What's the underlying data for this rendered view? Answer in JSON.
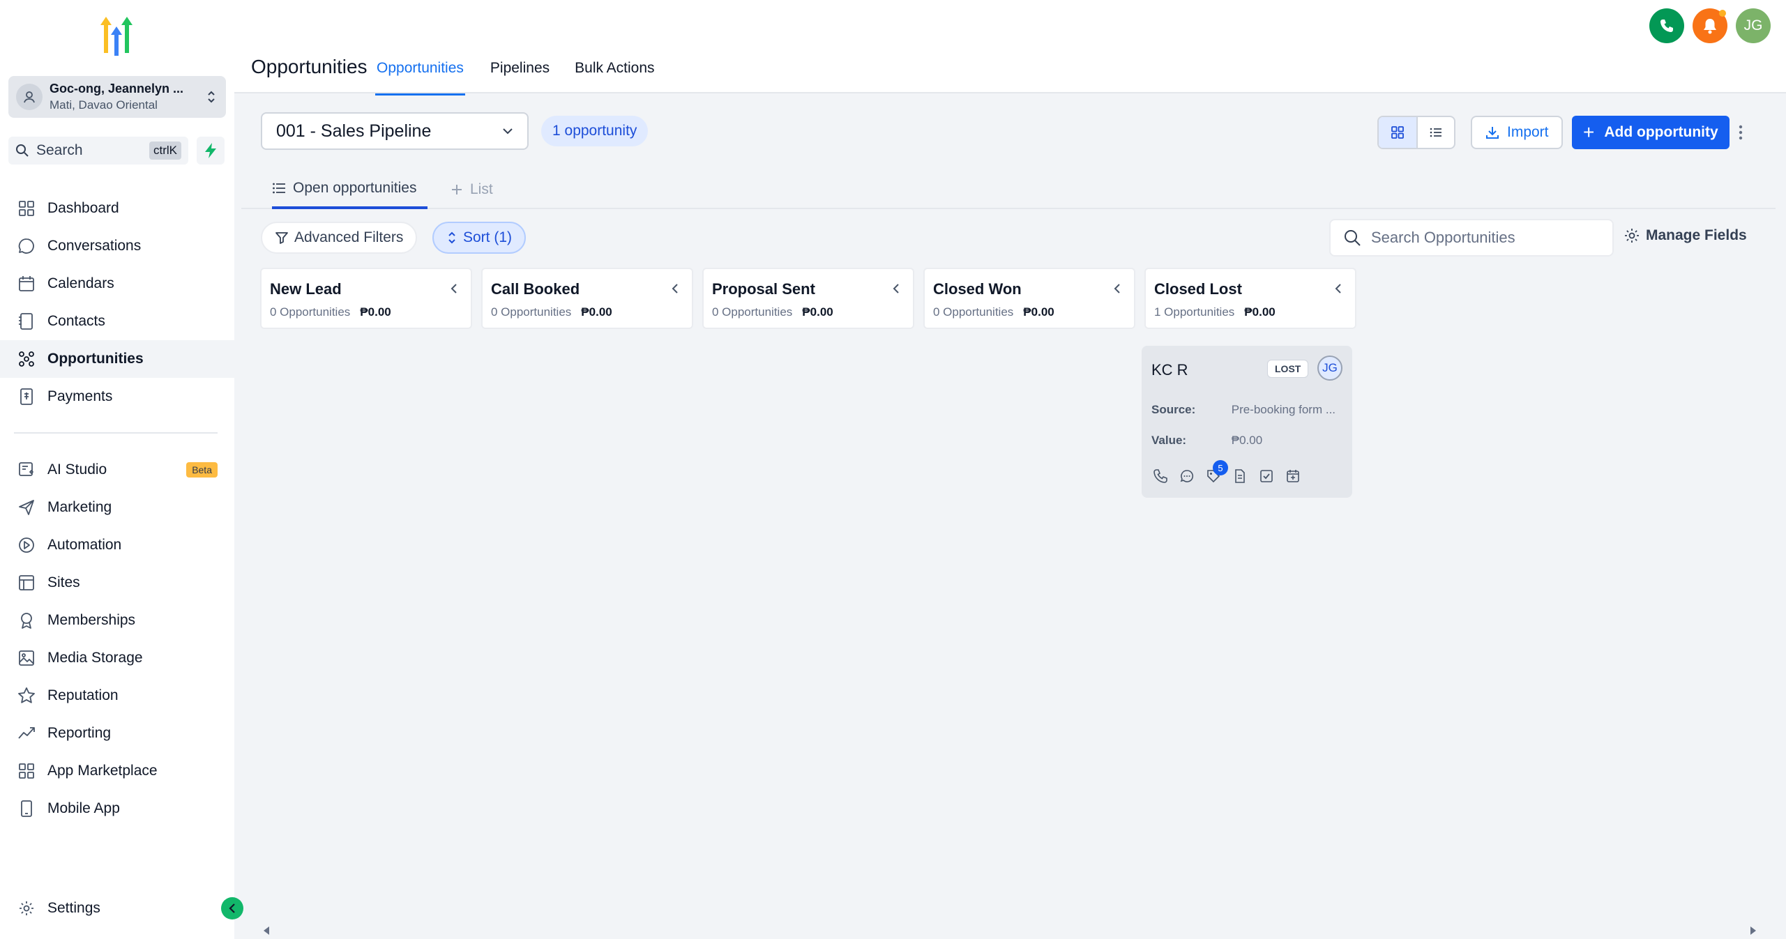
{
  "account": {
    "name": "Goc-ong, Jeannelyn ...",
    "location": "Mati, Davao Oriental"
  },
  "search": {
    "label": "Search",
    "shortcut": "ctrlK"
  },
  "nav_main": [
    {
      "label": "Dashboard",
      "icon": "dashboard-icon"
    },
    {
      "label": "Conversations",
      "icon": "chat-icon"
    },
    {
      "label": "Calendars",
      "icon": "calendar-icon"
    },
    {
      "label": "Contacts",
      "icon": "contacts-icon"
    },
    {
      "label": "Opportunities",
      "icon": "opportunities-icon",
      "active": true
    },
    {
      "label": "Payments",
      "icon": "payments-icon"
    }
  ],
  "nav_secondary": [
    {
      "label": "AI Studio",
      "icon": "ai-studio-icon",
      "badge": "Beta"
    },
    {
      "label": "Marketing",
      "icon": "send-icon"
    },
    {
      "label": "Automation",
      "icon": "automation-icon"
    },
    {
      "label": "Sites",
      "icon": "sites-icon"
    },
    {
      "label": "Memberships",
      "icon": "award-icon"
    },
    {
      "label": "Media Storage",
      "icon": "image-icon"
    },
    {
      "label": "Reputation",
      "icon": "star-icon"
    },
    {
      "label": "Reporting",
      "icon": "trend-icon"
    },
    {
      "label": "App Marketplace",
      "icon": "grid-icon"
    },
    {
      "label": "Mobile App",
      "icon": "phone-device-icon"
    }
  ],
  "settings_label": "Settings",
  "header": {
    "title": "Opportunities",
    "tabs": [
      "Opportunities",
      "Pipelines",
      "Bulk Actions"
    ],
    "user_initials": "JG"
  },
  "toolbar": {
    "pipeline": "001 - Sales Pipeline",
    "count": "1 opportunity",
    "import_label": "Import",
    "add_label": "Add opportunity"
  },
  "subtabs": {
    "open": "Open opportunities",
    "list": "List"
  },
  "filters": {
    "advanced": "Advanced Filters",
    "sort": "Sort (1)",
    "search_placeholder": "Search Opportunities",
    "manage_fields": "Manage Fields"
  },
  "columns": [
    {
      "title": "New Lead",
      "count": "0 Opportunities",
      "amount": "₱0.00"
    },
    {
      "title": "Call Booked",
      "count": "0 Opportunities",
      "amount": "₱0.00"
    },
    {
      "title": "Proposal Sent",
      "count": "0 Opportunities",
      "amount": "₱0.00"
    },
    {
      "title": "Closed Won",
      "count": "0 Opportunities",
      "amount": "₱0.00"
    },
    {
      "title": "Closed Lost",
      "count": "1 Opportunities",
      "amount": "₱0.00"
    }
  ],
  "card": {
    "name": "KC R",
    "status": "LOST",
    "assignee": "JG",
    "source_label": "Source:",
    "source_value": "Pre-booking form ...",
    "value_label": "Value:",
    "value_value": "₱0.00",
    "tag_count": "5"
  },
  "colors": {
    "primary": "#155eef",
    "accent_green": "#039855",
    "bell_orange": "#f97316",
    "avatar_green": "#7cb369"
  }
}
